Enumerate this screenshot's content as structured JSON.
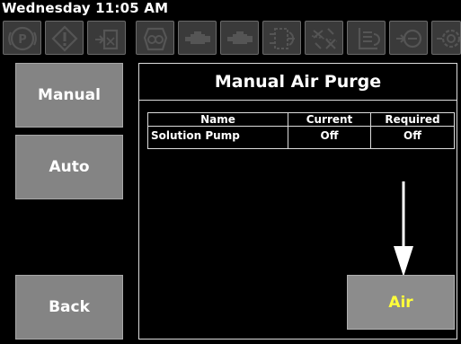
{
  "status_bar": {
    "datetime": "Wednesday 11:05 AM"
  },
  "icon_bar": {
    "icons": [
      "parking-brake-icon",
      "warning-icon",
      "solution-tank-icon",
      "vacuum-pump-icon",
      "engine-icon",
      "engine-alt-icon",
      "heat-exchanger-icon",
      "blower-icon",
      "water-heater-icon",
      "pump-icon",
      "chemical-pump-icon"
    ]
  },
  "sidebar": {
    "manual_label": "Manual",
    "auto_label": "Auto",
    "back_label": "Back"
  },
  "main": {
    "title": "Manual Air Purge",
    "table": {
      "headers": [
        "Name",
        "Current",
        "Required"
      ],
      "rows": [
        {
          "name": "Solution Pump",
          "current": "Off",
          "required": "Off"
        }
      ]
    },
    "air_label": "Air"
  },
  "colors": {
    "background": "#000000",
    "button_gray": "#848484",
    "air_text": "#ffff3a",
    "border": "#dcdcdc"
  }
}
